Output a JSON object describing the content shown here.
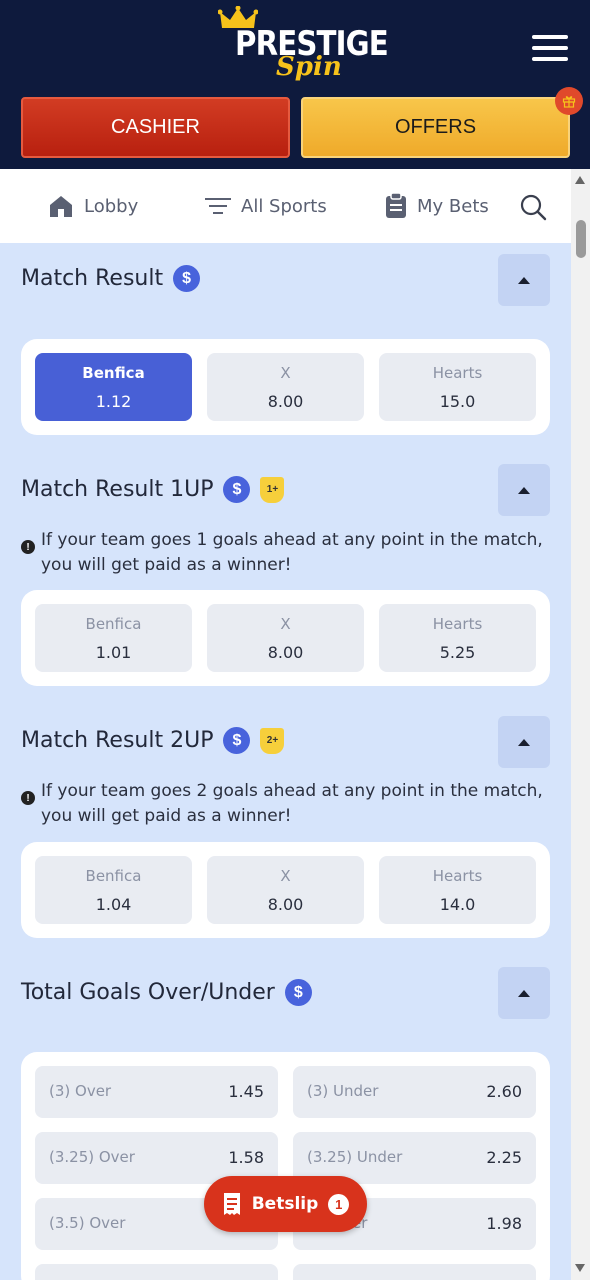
{
  "brand": {
    "name_line1": "PRESTIGE",
    "name_line2": "Spin"
  },
  "header": {
    "cashier_label": "CASHIER",
    "offers_label": "OFFERS"
  },
  "nav": {
    "items": [
      {
        "label": "Lobby",
        "icon": "home-icon"
      },
      {
        "label": "All Sports",
        "icon": "filter-lines-icon"
      },
      {
        "label": "My Bets",
        "icon": "clipboard-icon"
      }
    ],
    "search_icon": "search-icon"
  },
  "markets": [
    {
      "title": "Match Result",
      "badge": null,
      "note": null,
      "selections": [
        {
          "label": "Benfica",
          "odds": "1.12",
          "selected": true
        },
        {
          "label": "X",
          "odds": "8.00",
          "selected": false
        },
        {
          "label": "Hearts",
          "odds": "15.0",
          "selected": false
        }
      ]
    },
    {
      "title": "Match Result 1UP",
      "badge": "1+",
      "note": "If your team goes 1 goals ahead at any point in the match, you will get paid as a winner!",
      "selections": [
        {
          "label": "Benfica",
          "odds": "1.01",
          "selected": false
        },
        {
          "label": "X",
          "odds": "8.00",
          "selected": false
        },
        {
          "label": "Hearts",
          "odds": "5.25",
          "selected": false
        }
      ]
    },
    {
      "title": "Match Result 2UP",
      "badge": "2+",
      "note": "If your team goes 2 goals ahead at any point in the match, you will get paid as a winner!",
      "selections": [
        {
          "label": "Benfica",
          "odds": "1.04",
          "selected": false
        },
        {
          "label": "X",
          "odds": "8.00",
          "selected": false
        },
        {
          "label": "Hearts",
          "odds": "14.0",
          "selected": false
        }
      ]
    },
    {
      "title": "Total Goals Over/Under",
      "badge": null,
      "note": null,
      "rows": [
        {
          "over_label": "(3) Over",
          "over_odds": "1.45",
          "under_label": "(3) Under",
          "under_odds": "2.60"
        },
        {
          "over_label": "(3.25) Over",
          "over_odds": "1.58",
          "under_label": "(3.25) Under",
          "under_odds": "2.25"
        },
        {
          "over_label": "(3.5) Over",
          "over_odds": "",
          "under_label": "nder",
          "under_odds": "1.98"
        }
      ]
    }
  ],
  "betslip": {
    "label": "Betslip",
    "count": "1"
  },
  "colors": {
    "header_bg": "#0e1a3d",
    "page_bg": "#d6e4fb",
    "accent_blue": "#4860d6",
    "cashier_red": "#c52c18",
    "offers_yellow": "#f3b83a",
    "betslip_red": "#d8331c"
  }
}
